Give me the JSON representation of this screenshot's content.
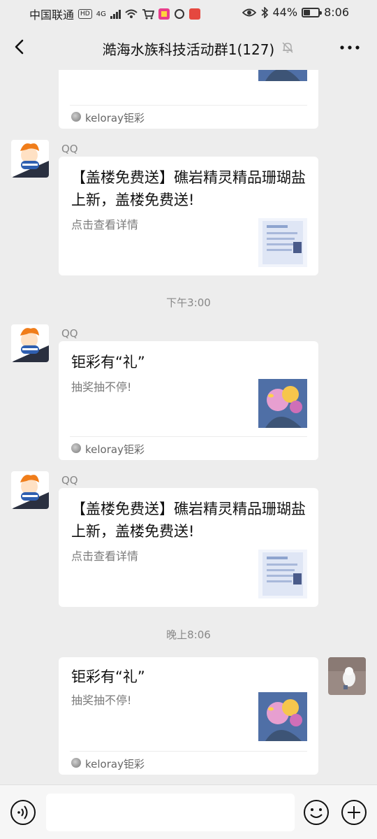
{
  "status_bar": {
    "carrier": "中国联通",
    "hd": "HD",
    "net": "4G",
    "battery_percent_text": "44%",
    "battery_level": 0.44,
    "time": "8:06"
  },
  "header": {
    "title": "澔海水族科技活动群1(127)"
  },
  "messages": [
    {
      "type": "card-partial",
      "footer": "keloray钜彩"
    },
    {
      "type": "card",
      "sender": "QQ",
      "title": "【盖楼免费送】礁岩精灵精品珊瑚盐上新，盖楼免费送!",
      "desc": "点击查看详情"
    },
    {
      "type": "time",
      "text": "下午3:00"
    },
    {
      "type": "card",
      "sender": "QQ",
      "title": "钜彩有“礼”",
      "desc": "抽奖抽不停!",
      "footer": "keloray钜彩"
    },
    {
      "type": "card",
      "sender": "QQ",
      "title": "【盖楼免费送】礁岩精灵精品珊瑚盐上新，盖楼免费送!",
      "desc": "点击查看详情"
    },
    {
      "type": "time",
      "text": "晚上8:06"
    },
    {
      "type": "card-self",
      "title": "钜彩有“礼”",
      "desc": "抽奖抽不停!",
      "footer": "keloray钜彩"
    }
  ],
  "input_bar": {
    "placeholder": ""
  },
  "icons": {
    "back": "back-arrow-icon",
    "mute": "mute-bell-icon",
    "more": "more-dots-icon",
    "voice": "voice-icon",
    "emoji": "emoji-icon",
    "plus": "plus-icon"
  },
  "colors": {
    "background": "#ededed",
    "card": "#ffffff",
    "thumb_blue": "#4f6fa6"
  }
}
